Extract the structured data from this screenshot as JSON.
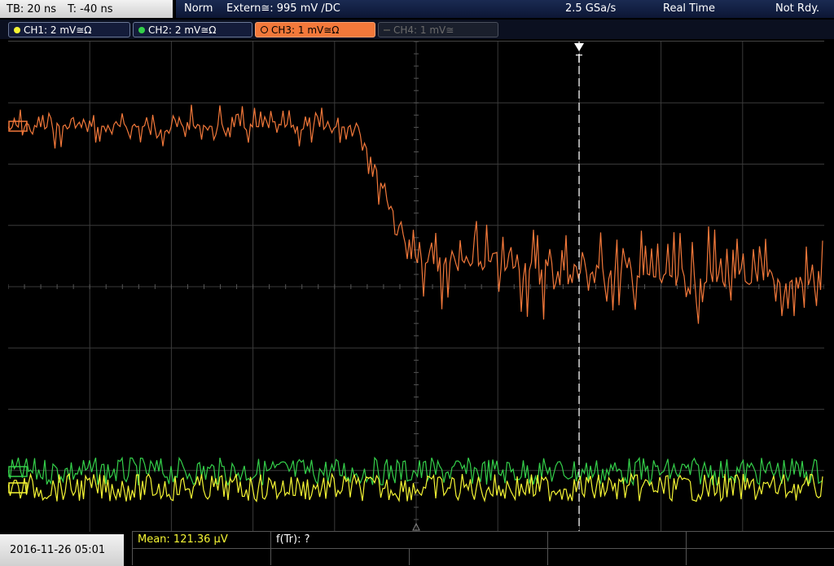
{
  "header": {
    "timebase": "TB: 20 ns",
    "trigger_time": "T: -40 ns",
    "trigger_mode": "Norm",
    "trigger_info": "Extern≅: 995 mV ∕DC",
    "sample_rate": "2.5 GSa/s",
    "acq_mode": "Real Time",
    "status": "Not Rdy."
  },
  "channels": [
    {
      "label": "CH1: 2 mV≅Ω",
      "color": "#f5f534"
    },
    {
      "label": "CH2: 2 mV≅Ω",
      "color": "#34d04a"
    },
    {
      "label": "CH3: 1 mV≅Ω",
      "color": "#f2783a"
    },
    {
      "label": "CH4: 1 mV≅",
      "color": "#6b6b6b"
    }
  ],
  "trigger_marker": "T",
  "footer": {
    "datetime": "2016-11-26 05:01",
    "mean": "Mean: 121.36 µV",
    "rise_time": "f(Tr): ?"
  },
  "colors": {
    "grid": "#3a3a3a",
    "ch1": "#f5f534",
    "ch2": "#34d04a",
    "ch3": "#f2783a",
    "trigger_line": "#ffffff"
  },
  "trace_names": [
    "ch3-trace",
    "ch2-trace",
    "ch1-trace"
  ]
}
